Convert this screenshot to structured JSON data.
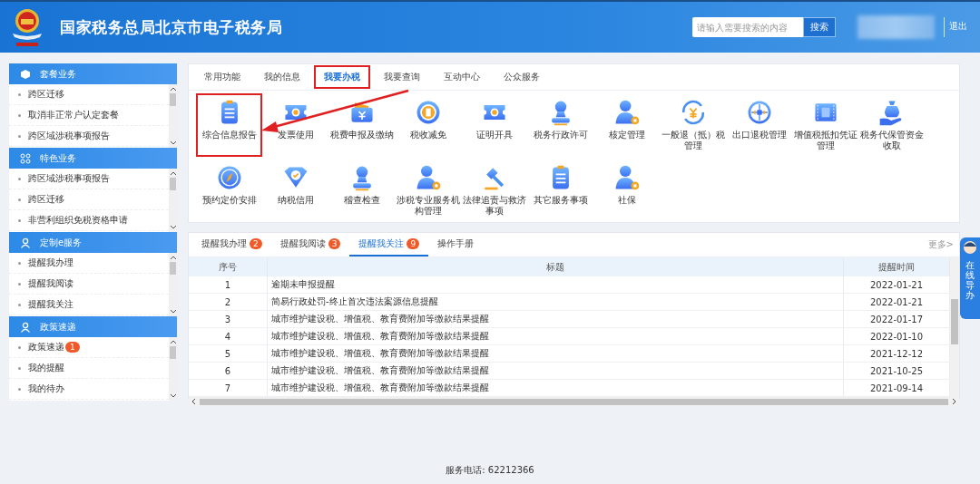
{
  "header": {
    "title": "国家税务总局北京市电子税务局",
    "search": {
      "placeholder": "请输入需要搜索的内容",
      "button": "搜索"
    },
    "logout": "退出"
  },
  "sidebar": [
    {
      "title": "套餐业务",
      "items": [
        {
          "label": "跨区迁移"
        },
        {
          "label": "取消非正常户认定套餐"
        },
        {
          "label": "跨区域涉税事项报告"
        }
      ]
    },
    {
      "title": "特色业务",
      "items": [
        {
          "label": "跨区域涉税事项报告"
        },
        {
          "label": "跨区迁移"
        },
        {
          "label": "非营利组织免税资格申请"
        }
      ]
    },
    {
      "title": "定制e服务",
      "items": [
        {
          "label": "提醒我办理"
        },
        {
          "label": "提醒我阅读"
        },
        {
          "label": "提醒我关注"
        }
      ]
    },
    {
      "title": "政策速递",
      "items": [
        {
          "label": "政策速递",
          "badge": "1"
        },
        {
          "label": "我的提醒"
        },
        {
          "label": "我的待办"
        }
      ]
    }
  ],
  "main_tabs": [
    {
      "label": "常用功能",
      "selected": false,
      "annotated": false
    },
    {
      "label": "我的信息",
      "selected": false,
      "annotated": false
    },
    {
      "label": "我要办税",
      "selected": true,
      "annotated": true
    },
    {
      "label": "我要查询",
      "selected": false,
      "annotated": false
    },
    {
      "label": "互动中心",
      "selected": false,
      "annotated": false
    },
    {
      "label": "公众服务",
      "selected": false,
      "annotated": false
    }
  ],
  "functions": [
    {
      "label": "综合信息报告",
      "annotated": true
    },
    {
      "label": "发票使用",
      "annotated": false
    },
    {
      "label": "税费申报及缴纳",
      "annotated": false
    },
    {
      "label": "税收减免",
      "annotated": false
    },
    {
      "label": "证明开具",
      "annotated": false
    },
    {
      "label": "税务行政许可",
      "annotated": false
    },
    {
      "label": "核定管理",
      "annotated": false
    },
    {
      "label": "一般退（抵）税管理",
      "annotated": false
    },
    {
      "label": "出口退税管理",
      "annotated": false
    },
    {
      "label": "增值税抵扣凭证管理",
      "annotated": false
    },
    {
      "label": "税务代保管资金收取",
      "annotated": false
    },
    {
      "label": "预约定价安排",
      "annotated": false
    },
    {
      "label": "纳税信用",
      "annotated": false
    },
    {
      "label": "稽查检查",
      "annotated": false
    },
    {
      "label": "涉税专业服务机构管理",
      "annotated": false
    },
    {
      "label": "法律追责与救济事项",
      "annotated": false
    },
    {
      "label": "其它服务事项",
      "annotated": false
    },
    {
      "label": "社保",
      "annotated": false
    }
  ],
  "remind_tabs": [
    {
      "label": "提醒我办理",
      "count": "2",
      "selected": false
    },
    {
      "label": "提醒我阅读",
      "count": "3",
      "selected": false
    },
    {
      "label": "提醒我关注",
      "count": "9",
      "selected": true
    },
    {
      "label": "操作手册",
      "selected": false
    }
  ],
  "more": "更多>",
  "table": {
    "columns": [
      "序号",
      "标题",
      "提醒时间"
    ],
    "rows": [
      [
        "1",
        "逾期未申报提醒",
        "2022-01-21"
      ],
      [
        "2",
        "简易行政处罚-终止首次违法案源信息提醒",
        "2022-01-21"
      ],
      [
        "3",
        "城市维护建设税、增值税、教育费附加等缴款结果提醒",
        "2022-01-17"
      ],
      [
        "4",
        "城市维护建设税、增值税、教育费附加等缴款结果提醒",
        "2022-01-10"
      ],
      [
        "5",
        "城市维护建设税、增值税、教育费附加等缴款结果提醒",
        "2021-12-12"
      ],
      [
        "6",
        "城市维护建设税、增值税、教育费附加等缴款结果提醒",
        "2021-10-25"
      ],
      [
        "7",
        "城市维护建设税、增值税、教育费附加等缴款结果提醒",
        "2021-09-14"
      ]
    ]
  },
  "float_tab": "在线导办",
  "footer": "服务电话: 62212366"
}
